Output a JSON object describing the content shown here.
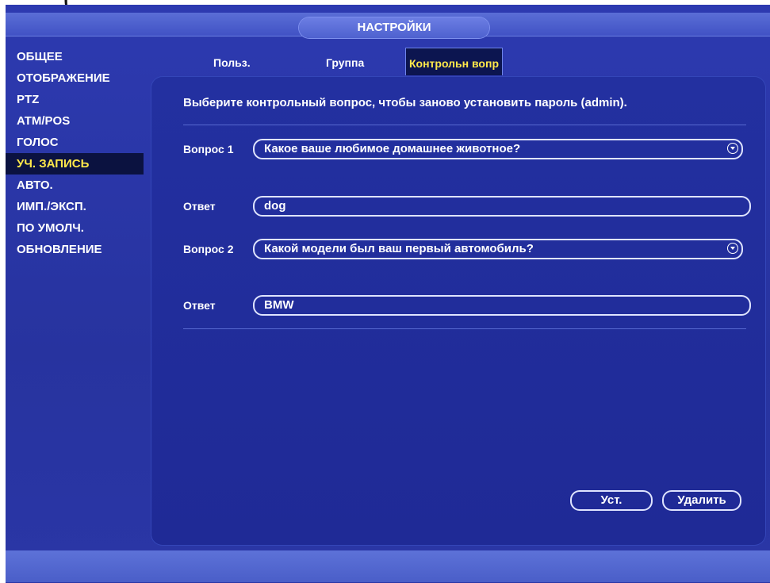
{
  "window": {
    "top_text": "(",
    "title": "НАСТРОЙКИ"
  },
  "sidebar": {
    "items": [
      {
        "label": "ОБЩЕЕ"
      },
      {
        "label": "ОТОБРАЖЕНИЕ"
      },
      {
        "label": "PTZ"
      },
      {
        "label": "ATM/POS"
      },
      {
        "label": "ГОЛОС"
      },
      {
        "label": "УЧ. ЗАПИСЬ",
        "active": true
      },
      {
        "label": "АВТО."
      },
      {
        "label": "ИМП./ЭКСП."
      },
      {
        "label": "ПО УМОЛЧ."
      },
      {
        "label": "ОБНОВЛЕНИЕ"
      }
    ]
  },
  "tabs": [
    {
      "label": "Польз."
    },
    {
      "label": "Группа"
    },
    {
      "label": "Контрольн вопр",
      "active": true
    }
  ],
  "form": {
    "instruction": "Выберите контрольный вопрос, чтобы заново установить пароль (admin).",
    "question1": {
      "label": "Вопрос 1",
      "value": "Какое ваше любимое домашнее животное?"
    },
    "answer1": {
      "label": "Ответ",
      "value": "dog"
    },
    "question2": {
      "label": "Вопрос 2",
      "value": "Какой модели был ваш первый автомобиль?"
    },
    "answer2": {
      "label": "Ответ",
      "value": "BMW"
    }
  },
  "buttons": {
    "set": "Уст.",
    "delete": "Удалить"
  },
  "colors": {
    "background": "#2a35a6",
    "active_text": "#ffe84a",
    "active_bg": "#0b1240",
    "text": "#ffffff"
  },
  "icons": {
    "dropdown": "chevron-down-circle-icon"
  }
}
